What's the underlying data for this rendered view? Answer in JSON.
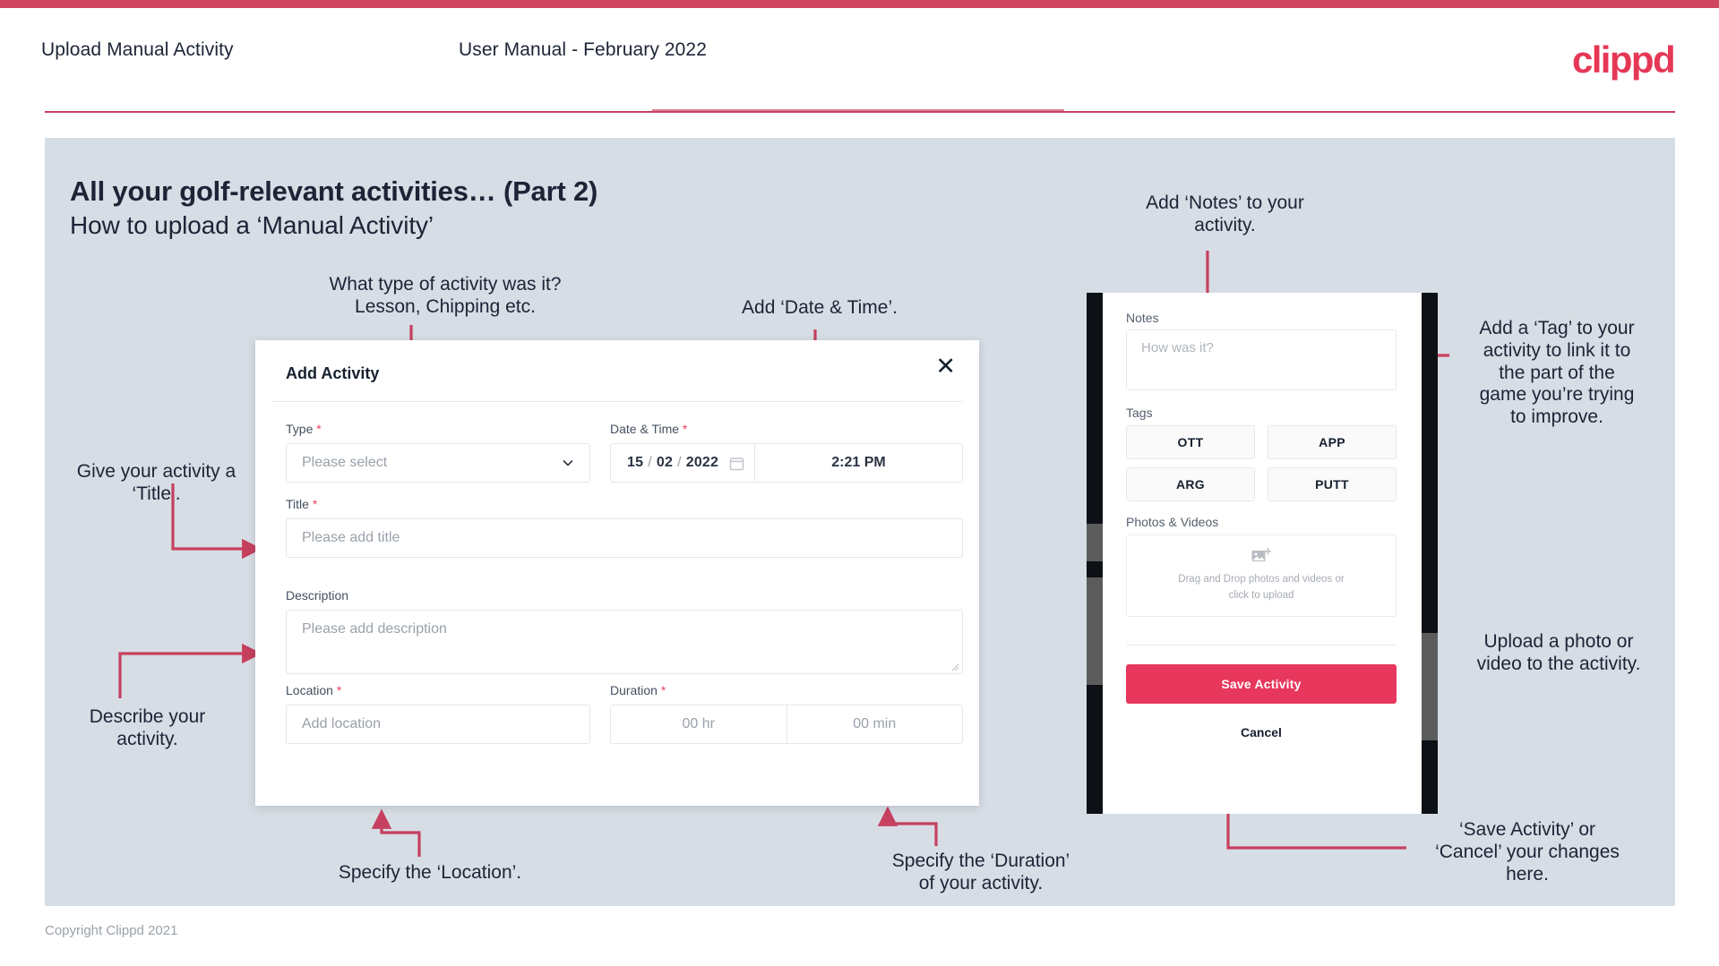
{
  "header": {
    "title": "Upload Manual Activity",
    "subtitle": "User Manual - February 2022",
    "logo": "clippd"
  },
  "slide": {
    "title": "All your golf-relevant activities… (Part 2)",
    "subtitle": "How to upload a ‘Manual Activity’"
  },
  "annotations": {
    "type": "What type of activity was it?\nLesson, Chipping etc.",
    "datetime": "Add ‘Date & Time’.",
    "title": "Give your activity a\n‘Title’.",
    "description": "Describe your\nactivity.",
    "location": "Specify the ‘Location’.",
    "duration": "Specify the ‘Duration’\nof your activity.",
    "notes": "Add ‘Notes’ to your\nactivity.",
    "tags": "Add a ‘Tag’ to your\nactivity to link it to\nthe part of the\ngame you’re trying\nto improve.",
    "upload": "Upload a photo or\nvideo to the activity.",
    "save": "‘Save Activity’ or\n‘Cancel’ your changes\nhere."
  },
  "dialog": {
    "title": "Add Activity",
    "close_icon": "close-icon",
    "fields": {
      "type": {
        "label": "Type",
        "required": "*",
        "placeholder": "Please select"
      },
      "datetime": {
        "label": "Date & Time",
        "required": "*",
        "day": "15",
        "month": "02",
        "year": "2022",
        "sep": "/",
        "time": "2:21 PM"
      },
      "title": {
        "label": "Title",
        "required": "*",
        "placeholder": "Please add title"
      },
      "description": {
        "label": "Description",
        "placeholder": "Please add description"
      },
      "location": {
        "label": "Location",
        "required": "*",
        "placeholder": "Add location"
      },
      "duration": {
        "label": "Duration",
        "required": "*",
        "hours": "00 hr",
        "minutes": "00 min"
      }
    }
  },
  "phone": {
    "notes": {
      "label": "Notes",
      "placeholder": "How was it?"
    },
    "tags": {
      "label": "Tags",
      "options": [
        "OTT",
        "APP",
        "ARG",
        "PUTT"
      ]
    },
    "photos": {
      "label": "Photos & Videos",
      "dropzone_line1": "Drag and Drop photos and videos or",
      "dropzone_line2": "click to upload",
      "icon": "add-image-icon"
    },
    "save_label": "Save Activity",
    "cancel_label": "Cancel"
  },
  "footer": {
    "copyright": "Copyright Clippd 2021"
  },
  "colors": {
    "brand_pink": "#e8375c",
    "top_bar": "#d0455f",
    "slide_bg": "#d7dde5",
    "ink": "#1c2436",
    "arrow": "#c6405f"
  }
}
